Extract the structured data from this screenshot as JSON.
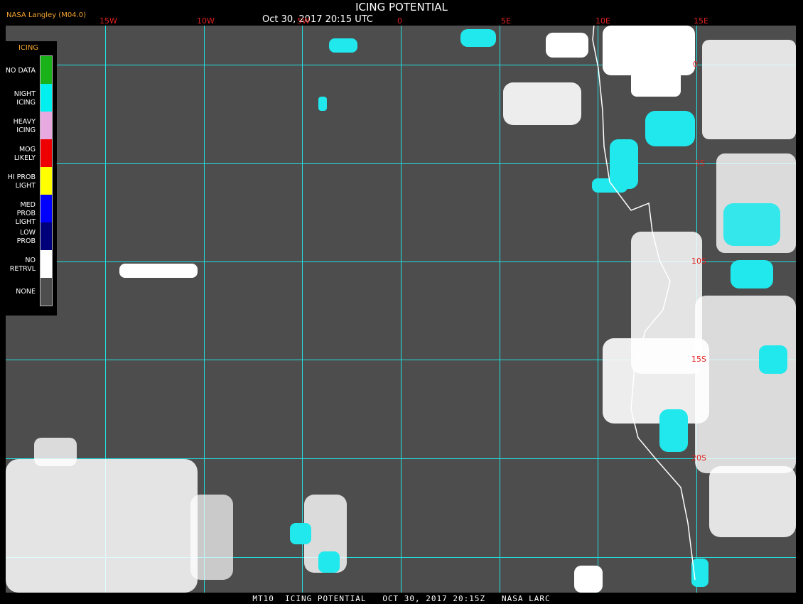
{
  "header": {
    "title": "ICING POTENTIAL",
    "subtitle": "Oct 30, 2017 20:15 UTC",
    "credit": "NASA Langley (M04.0)"
  },
  "legend": {
    "title": "ICING",
    "items": [
      {
        "label": "NO DATA",
        "color": "#19b219"
      },
      {
        "label": "NIGHT ICING",
        "color": "#00f0f0"
      },
      {
        "label": "HEAVY ICING",
        "color": "#e8a8e0"
      },
      {
        "label": "MOG LIKELY",
        "color": "#ee0000"
      },
      {
        "label": "HI PROB LIGHT",
        "color": "#ffff00"
      },
      {
        "label": "MED PROB LIGHT",
        "color": "#0000ff"
      },
      {
        "label": "LOW PROB",
        "color": "#00007a"
      },
      {
        "label": "NO RETRVL",
        "color": "#ffffff"
      },
      {
        "label": "NONE",
        "color": "#4d4d4d"
      }
    ]
  },
  "map": {
    "lon_labels": [
      "15W",
      "10W",
      "5W",
      "0",
      "5E",
      "10E",
      "15E"
    ],
    "lat_labels": [
      "0",
      "5S",
      "10S",
      "15S",
      "20S"
    ]
  },
  "footer": "MT10  ICING POTENTIAL   OCT 30, 2017 20:15Z   NASA LARC"
}
